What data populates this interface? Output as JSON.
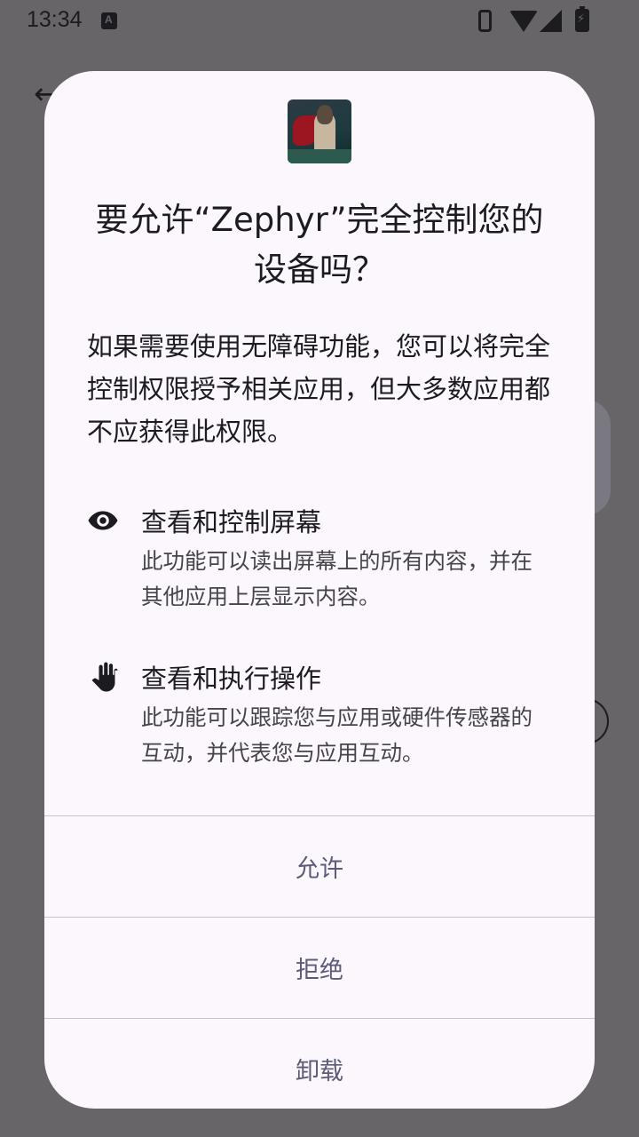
{
  "status_bar": {
    "time": "13:34"
  },
  "dialog": {
    "title": "要允许“Zephyr”完全控制您的设备吗？",
    "message": "如果需要使用无障碍功能，您可以将完全控制权限授予相关应用，但大多数应用都不应获得此权限。",
    "permissions": [
      {
        "icon": "eye-icon",
        "title": "查看和控制屏幕",
        "description": "此功能可以读出屏幕上的所有内容，并在其他应用上层显示内容。"
      },
      {
        "icon": "hand-icon",
        "title": "查看和执行操作",
        "description": "此功能可以跟踪您与应用或硬件传感器的互动，并代表您与应用互动。"
      }
    ],
    "buttons": {
      "allow": "允许",
      "deny": "拒绝",
      "uninstall": "卸载"
    }
  },
  "colors": {
    "scrim": "#676568",
    "dialog_bg": "#fbf7fc",
    "button_text": "#5f5a7a"
  }
}
